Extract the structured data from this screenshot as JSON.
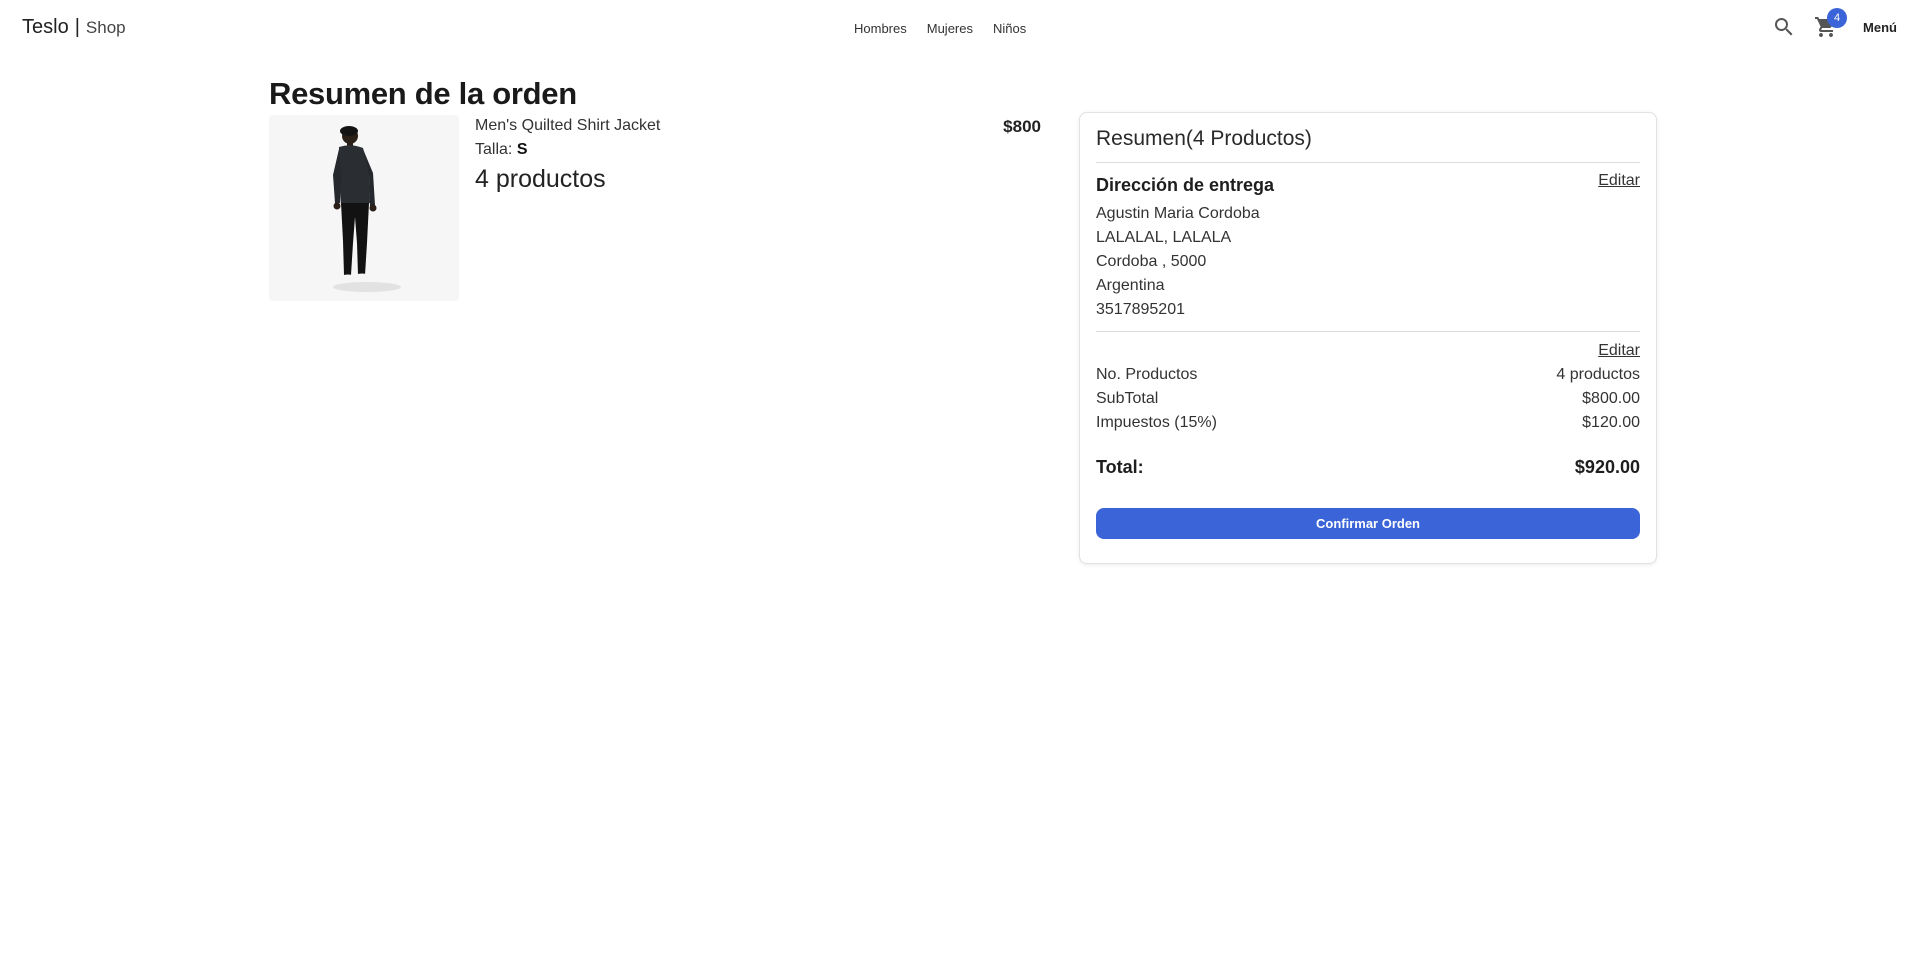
{
  "brand": {
    "name": "Teslo",
    "separator": "|",
    "sub": "Shop"
  },
  "nav": {
    "links": [
      "Hombres",
      "Mujeres",
      "Niños"
    ],
    "cart_count": "4",
    "menu_label": "Menú",
    "icons": {
      "search": "search-icon",
      "cart": "cart-icon"
    }
  },
  "page": {
    "title": "Resumen de la orden"
  },
  "product": {
    "name": "Men's Quilted Shirt Jacket",
    "size_label": "Talla:",
    "size_value": "S",
    "quantity_text": "4 productos",
    "price": "$800"
  },
  "summary": {
    "title": "Resumen(4 Productos)",
    "address_heading": "Dirección de entrega",
    "edit_label": "Editar",
    "address_lines": [
      "Agustin Maria Cordoba",
      "LALALAL, LALALA",
      "Cordoba , 5000",
      "Argentina",
      "3517895201"
    ],
    "rows": [
      {
        "label": "No. Productos",
        "value": "4 productos"
      },
      {
        "label": "SubTotal",
        "value": "$800.00"
      },
      {
        "label": "Impuestos (15%)",
        "value": "$120.00"
      }
    ],
    "total_label": "Total:",
    "total_value": "$920.00",
    "confirm_label": "Confirmar Orden"
  },
  "colors": {
    "accent": "#3a64d8"
  }
}
